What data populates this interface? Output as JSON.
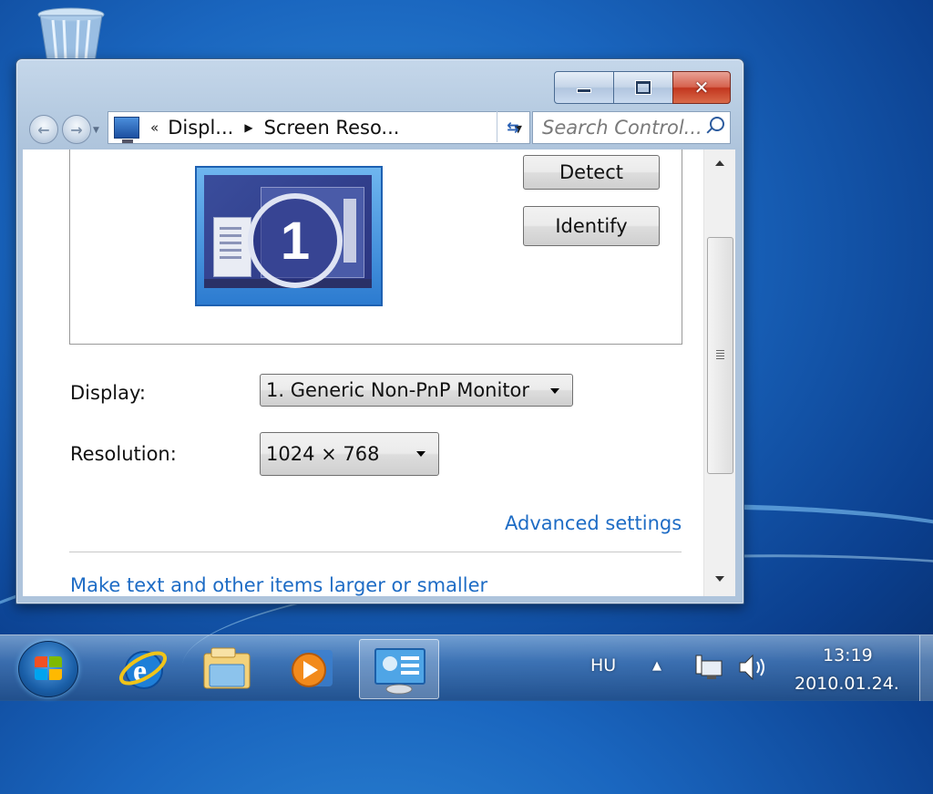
{
  "window": {
    "title_buttons": {
      "minimize": "minimize",
      "maximize": "maximize",
      "close": "✕"
    },
    "address": {
      "overflow": "«",
      "crumbs": [
        "Displ...",
        "Screen Reso..."
      ]
    },
    "search": {
      "placeholder": "Search Control..."
    }
  },
  "main": {
    "monitor_number": "1",
    "detect_label": "Detect",
    "identify_label": "Identify",
    "display_label": "Display:",
    "display_value": "1. Generic Non-PnP Monitor",
    "resolution_label": "Resolution:",
    "resolution_value": "1024 × 768",
    "advanced_link": "Advanced settings",
    "larger_link": "Make text and other items larger or smaller"
  },
  "taskbar": {
    "apps": [
      "start-orb",
      "internet-explorer",
      "windows-explorer",
      "media-player",
      "control-panel"
    ],
    "active_app": "control-panel",
    "language": "HU",
    "time": "13:19",
    "date": "2010.01.24."
  },
  "colors": {
    "link": "#1e6cc5",
    "close_button": "#c2361f"
  }
}
